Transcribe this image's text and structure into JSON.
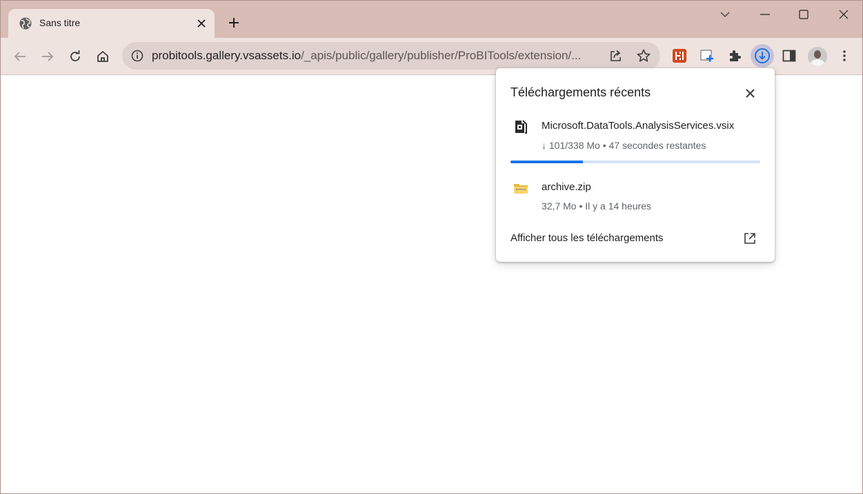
{
  "tab": {
    "title": "Sans titre",
    "icon": "globe-icon"
  },
  "toolbar": {
    "url_host": "probitools.gallery.vsassets.io",
    "url_path": "/_apis/public/gallery/publisher/ProBITools/extension/..."
  },
  "downloads": {
    "title": "Téléchargements récents",
    "items": [
      {
        "name": "Microsoft.DataTools.AnalysisServices.vsix",
        "status": "↓ 101/338 Mo • 47 secondes restantes",
        "progress": 0.29,
        "icon": "vsix-file-icon"
      },
      {
        "name": "archive.zip",
        "status": "32,7 Mo • Il y a 14 heures",
        "icon": "zip-folder-icon"
      }
    ],
    "show_all": "Afficher tous les téléchargements"
  },
  "colors": {
    "frame": "#d8bcb5",
    "toolbar": "#efe3e0",
    "omnibox": "#dfd1cd",
    "accent": "#1a73e8"
  }
}
